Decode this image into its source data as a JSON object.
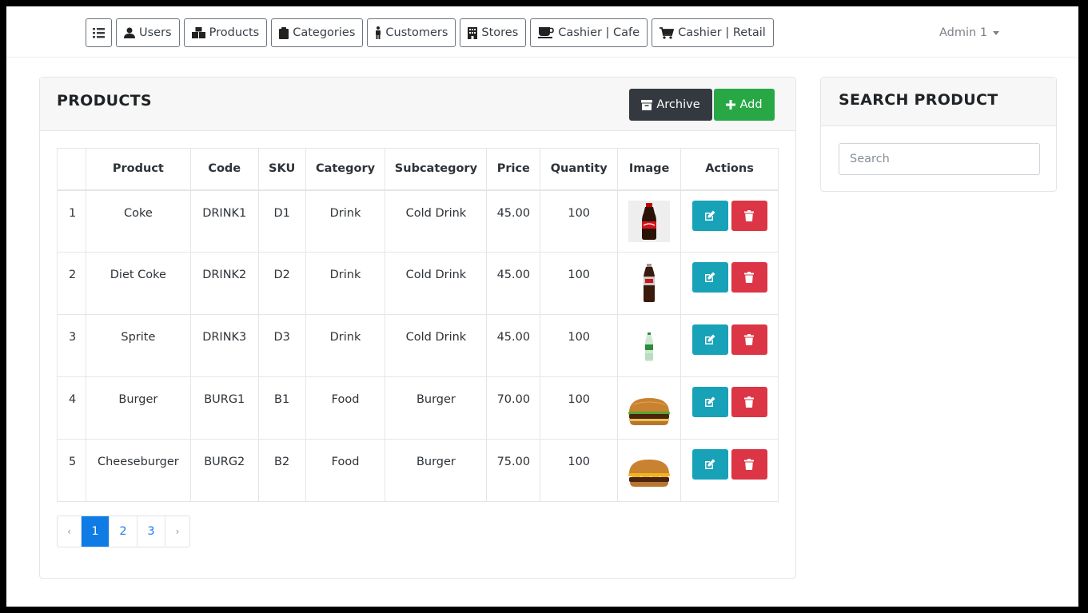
{
  "nav": {
    "items": [
      {
        "label": "Users"
      },
      {
        "label": "Products"
      },
      {
        "label": "Categories"
      },
      {
        "label": "Customers"
      },
      {
        "label": "Stores"
      },
      {
        "label": "Cashier | Cafe"
      },
      {
        "label": "Cashier | Retail"
      }
    ],
    "admin": "Admin 1"
  },
  "products": {
    "title": "PRODUCTS",
    "archive_label": "Archive",
    "add_label": "Add",
    "columns": [
      "",
      "Product",
      "Code",
      "SKU",
      "Category",
      "Subcategory",
      "Price",
      "Quantity",
      "Image",
      "Actions"
    ],
    "rows": [
      {
        "num": "1",
        "product": "Coke",
        "code": "DRINK1",
        "sku": "D1",
        "category": "Drink",
        "subcategory": "Cold Drink",
        "price": "45.00",
        "quantity": "100",
        "image": "coke-bottle"
      },
      {
        "num": "2",
        "product": "Diet Coke",
        "code": "DRINK2",
        "sku": "D2",
        "category": "Drink",
        "subcategory": "Cold Drink",
        "price": "45.00",
        "quantity": "100",
        "image": "diet-coke-bottle"
      },
      {
        "num": "3",
        "product": "Sprite",
        "code": "DRINK3",
        "sku": "D3",
        "category": "Drink",
        "subcategory": "Cold Drink",
        "price": "45.00",
        "quantity": "100",
        "image": "sprite-bottle"
      },
      {
        "num": "4",
        "product": "Burger",
        "code": "BURG1",
        "sku": "B1",
        "category": "Food",
        "subcategory": "Burger",
        "price": "70.00",
        "quantity": "100",
        "image": "burger"
      },
      {
        "num": "5",
        "product": "Cheeseburger",
        "code": "BURG2",
        "sku": "B2",
        "category": "Food",
        "subcategory": "Burger",
        "price": "75.00",
        "quantity": "100",
        "image": "cheeseburger"
      }
    ]
  },
  "pagination": {
    "prev": "‹",
    "next": "›",
    "pages": [
      "1",
      "2",
      "3"
    ],
    "active": "1"
  },
  "search": {
    "title": "SEARCH PRODUCT",
    "placeholder": "Search"
  },
  "colors": {
    "primary": "#0f7ce6",
    "success": "#28a745",
    "info": "#17a2b8",
    "danger": "#dc3545",
    "dark": "#33393e"
  }
}
